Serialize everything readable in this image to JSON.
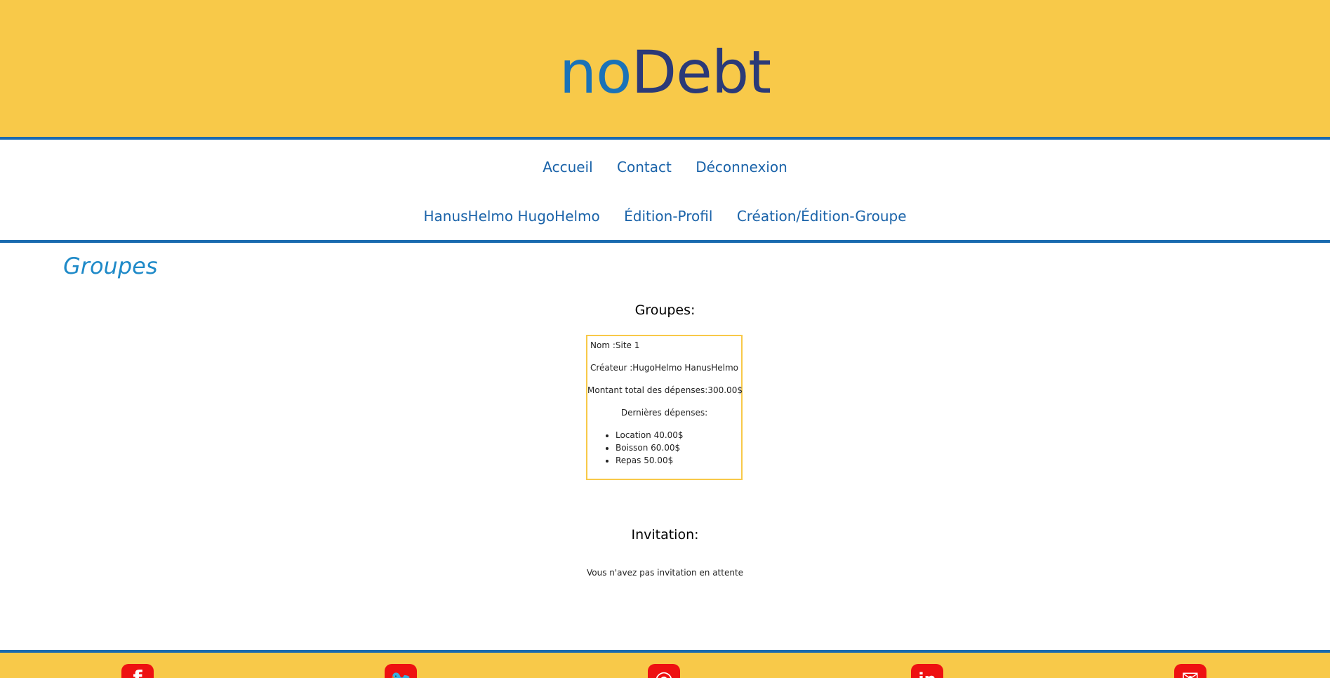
{
  "brand": {
    "part1": "no",
    "part2": "Debt"
  },
  "nav": {
    "row1": [
      "Accueil",
      "Contact",
      "Déconnexion"
    ],
    "row2": [
      "HanusHelmo HugoHelmo",
      "Édition-Profil",
      "Création/Édition-Groupe"
    ]
  },
  "page": {
    "heading": "Groupes"
  },
  "groups_section": {
    "title": "Groupes:",
    "group": {
      "nom": "Nom :Site 1",
      "createur": "Créateur :HugoHelmo HanusHelmo",
      "montant": "Montant total des dépenses:300.00$",
      "dernieres_label": "Dernières dépenses:",
      "depenses": [
        "Location 40.00$",
        "Boisson 60.00$",
        "Repas 50.00$"
      ]
    }
  },
  "invitation_section": {
    "title": "Invitation:",
    "message": "Vous n'avez pas invitation en attente"
  },
  "footer": {
    "icons": [
      {
        "name": "facebook-icon",
        "glyph": "f"
      },
      {
        "name": "twitter-icon",
        "glyph": "🐦"
      },
      {
        "name": "instagram-icon",
        "glyph": "◎"
      },
      {
        "name": "linkedin-icon",
        "glyph": "in"
      },
      {
        "name": "mail-icon",
        "glyph": "✉"
      }
    ]
  },
  "colors": {
    "header_bg": "#f8c949",
    "accent_blue": "#1a6aaf",
    "social_red": "#ee1111"
  }
}
